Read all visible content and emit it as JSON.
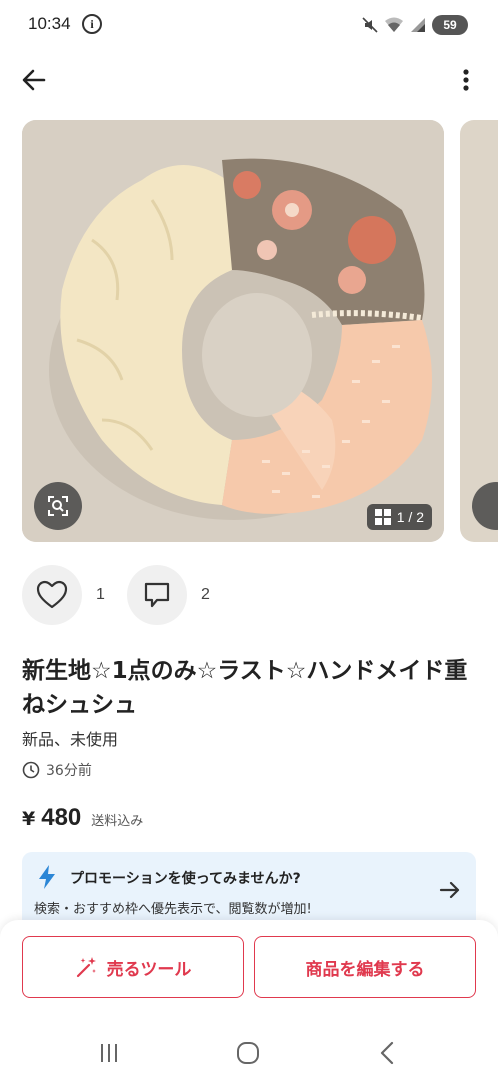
{
  "status_bar": {
    "time": "10:34",
    "info_icon": "info-icon",
    "icons": [
      "mute-icon",
      "wifi-icon",
      "signal-icon"
    ],
    "battery": "59"
  },
  "app_bar": {
    "back_icon": "arrow-left-icon",
    "menu_icon": "more-vert-icon"
  },
  "gallery": {
    "counter": "1 / 2"
  },
  "actions": {
    "likes": "1",
    "comments": "2"
  },
  "item": {
    "title": "新生地☆1点のみ☆ラスト☆ハンドメイド重ねシュシュ",
    "condition": "新品、未使用",
    "posted": "36分前",
    "price_symbol": "¥",
    "price": "480",
    "shipping": "送料込み"
  },
  "promo": {
    "title": "プロモーションを使ってみませんか?",
    "subtitle": "検索・おすすめ枠へ優先表示で、閲覧数が増加!"
  },
  "bottom_actions": {
    "sell_tools": "売るツール",
    "edit_item": "商品を編集する"
  },
  "colors": {
    "accent": "#e0394e",
    "promo_bg": "#e9f3fc",
    "bolt": "#2b86d6"
  }
}
